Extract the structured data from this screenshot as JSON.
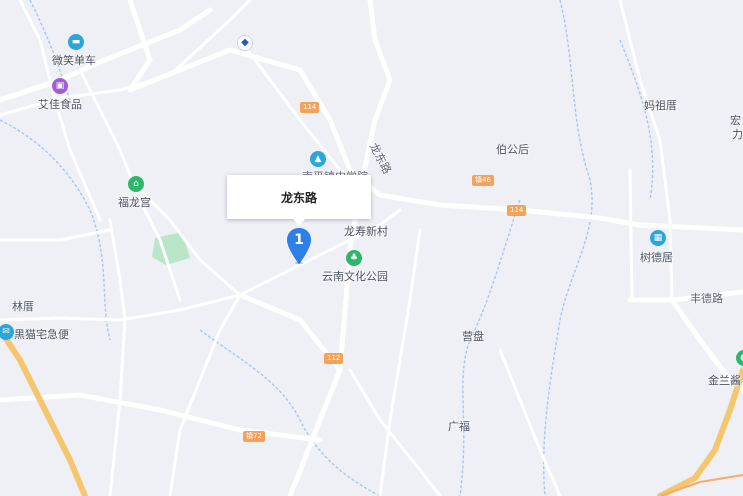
{
  "callout": {
    "title": "龙东路"
  },
  "marker": {
    "number": "1"
  },
  "labels": {
    "weixiao": "微笑单车",
    "aijia": "艾佳食品",
    "fulonggong": "福龙宫",
    "longshou": "龙寿新村",
    "yunnan_park": "云南文化公园",
    "linlin": "林厝",
    "heimao": "黑猫宅急便",
    "yingpan": "营盘",
    "guangfu": "广福",
    "bogonghou": "伯公后",
    "mazucuo": "妈祖厝",
    "shudeju": "树德居",
    "fengde_road": "丰德路",
    "jinlan": "金兰酱",
    "longdong_road": "龙东路",
    "partial_hong": "宏",
    "partial_li": "力",
    "partial_school": "南平镇中学院"
  },
  "shields": {
    "r114_a": "114",
    "r114_b": "114",
    "r112": "112",
    "x46": "镇46",
    "x72": "镇72"
  },
  "colors": {
    "background": "#eef0f5",
    "road": "#ffffff",
    "highway": "#f6c66f",
    "river": "#a9c6ea",
    "park": "#b8e6c6",
    "marker": "#2f7fe8",
    "poi_blue": "#2aa6d8",
    "poi_purple": "#a35bd6",
    "poi_green": "#2fb66c",
    "poi_teal": "#2bb0c0"
  }
}
